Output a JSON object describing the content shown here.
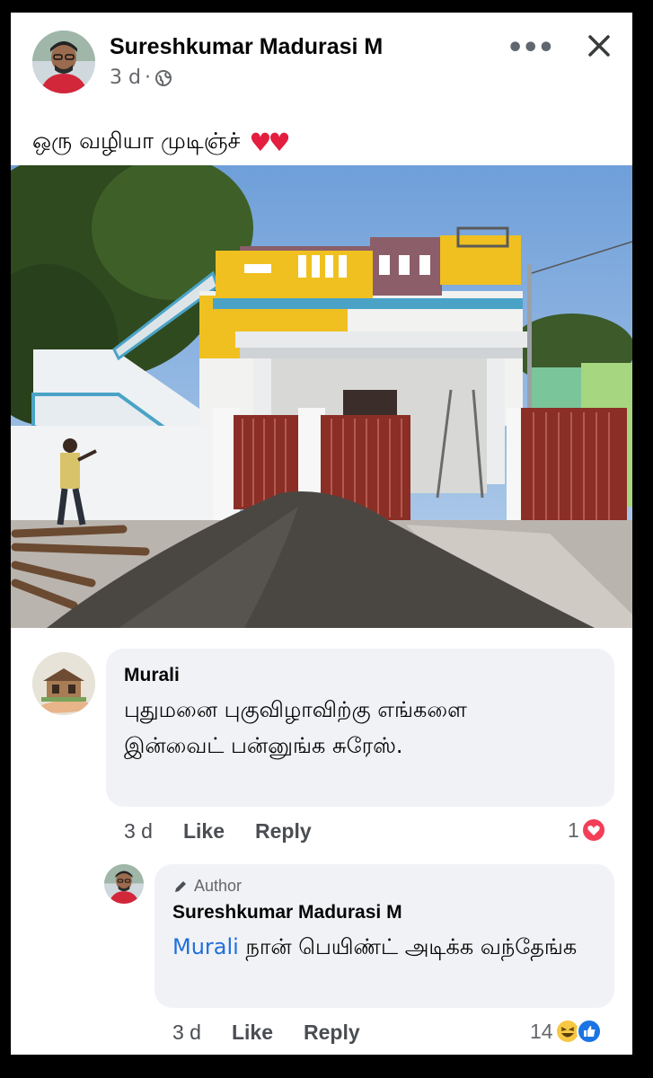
{
  "post": {
    "author": "Sureshkumar Madurasi M",
    "time": "3 d",
    "separator": "·",
    "privacy_icon": "globe-icon",
    "caption": "ஒரு வழியா முடிஞ்ச்",
    "caption_emoji": "♥♥",
    "menu_icon": "more-options-icon",
    "close_icon": "close-icon"
  },
  "comments": [
    {
      "author": "Murali",
      "text": "புதுமனை புகுவிழாவிற்கு எங்களை இன்வைட் பன்னுங்க சுரேஸ்.",
      "time": "3 d",
      "like_label": "Like",
      "reply_label": "Reply",
      "reaction_count": "1",
      "reaction_icon": "love-reaction-icon"
    }
  ],
  "reply": {
    "badge": "Author",
    "author": "Sureshkumar Madurasi M",
    "mention": "Murali",
    "text": " நான் பெயிண்ட் அடிக்க வந்தேங்க",
    "time": "3 d",
    "like_label": "Like",
    "reply_label": "Reply",
    "reaction_count": "14",
    "reaction_icons": [
      "haha-reaction-icon",
      "like-reaction-icon"
    ]
  }
}
